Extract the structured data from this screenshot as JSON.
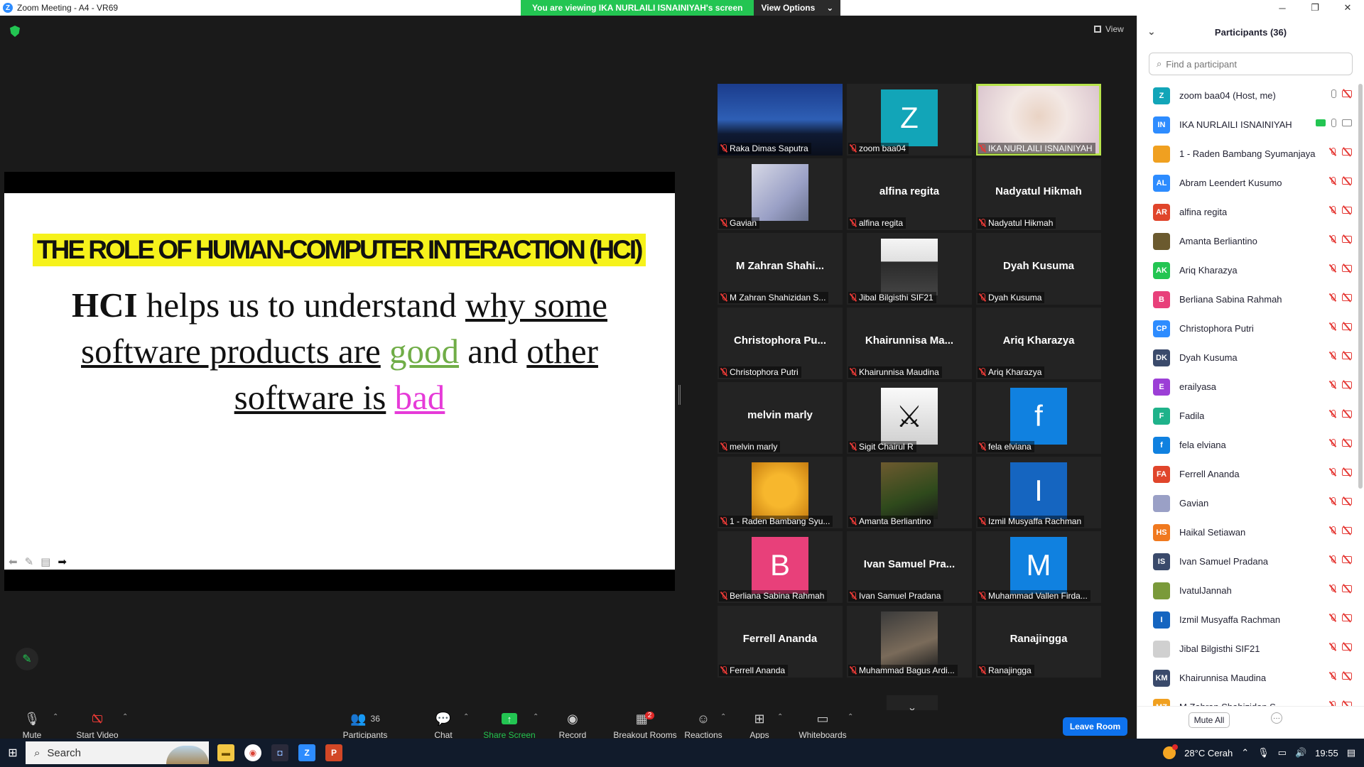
{
  "window": {
    "title": "Zoom Meeting - A4 - VR69",
    "banner_text": "You are viewing IKA NURLAILI ISNAINIYAH's screen",
    "view_options_label": "View Options",
    "minimize": "─",
    "restore": "❐",
    "close": "✕"
  },
  "top_view_label": "View",
  "slide": {
    "title": "THE ROLE OF HUMAN-COMPUTER INTERACTION (HCI)",
    "body": {
      "hci": "HCI",
      "t1": " helps us to understand ",
      "u1": "why some software products are",
      "t2": " ",
      "good": "good",
      "t3": " and ",
      "u2": "other software is",
      "t4": " ",
      "bad": "bad"
    }
  },
  "gallery": {
    "tiles": [
      {
        "name": "Raka Dimas Saputra",
        "center": "",
        "thumb": "",
        "style": "city"
      },
      {
        "name": "zoom baa04",
        "center": "",
        "thumb": "Z",
        "style": "avatar",
        "color": "#12a5b8"
      },
      {
        "name": "IKA NURLAILI ISNAINIYAH",
        "center": "",
        "thumb": "",
        "style": "face",
        "active": true
      },
      {
        "name": "Gavian",
        "center": "",
        "thumb": "",
        "style": "anime"
      },
      {
        "name": "alfina regita",
        "center": "alfina regita",
        "thumb": "",
        "style": "none"
      },
      {
        "name": "Nadyatul Hikmah",
        "center": "Nadyatul Hikmah",
        "thumb": "",
        "style": "none"
      },
      {
        "name": "M Zahran Shahizidan S...",
        "center": "M Zahran Shahi...",
        "thumb": "",
        "style": "none"
      },
      {
        "name": "Jibal Bilgisthi SIF21",
        "center": "",
        "thumb": "",
        "style": "man"
      },
      {
        "name": "Dyah Kusuma",
        "center": "Dyah Kusuma",
        "thumb": "",
        "style": "none"
      },
      {
        "name": "Christophora Putri",
        "center": "Christophora Pu...",
        "thumb": "",
        "style": "none"
      },
      {
        "name": "Khairunnisa Maudina",
        "center": "Khairunnisa Ma...",
        "thumb": "",
        "style": "none"
      },
      {
        "name": "Ariq Kharazya",
        "center": "Ariq Kharazya",
        "thumb": "",
        "style": "none"
      },
      {
        "name": "melvin marly",
        "center": "melvin marly",
        "thumb": "",
        "style": "none"
      },
      {
        "name": "Sigit Chairul R",
        "center": "",
        "thumb": "⚔",
        "style": "samurai"
      },
      {
        "name": "fela elviana",
        "center": "",
        "thumb": "f",
        "style": "avatar",
        "color": "#1081e0"
      },
      {
        "name": "1 - Raden Bambang Syu...",
        "center": "",
        "thumb": "",
        "style": "jake"
      },
      {
        "name": "Amanta Berliantino",
        "center": "",
        "thumb": "",
        "style": "forest"
      },
      {
        "name": "Izmil Musyaffa Rachman",
        "center": "",
        "thumb": "I",
        "style": "avatar",
        "color": "#1565c0"
      },
      {
        "name": "Berliana Sabina Rahmah",
        "center": "",
        "thumb": "B",
        "style": "avatar",
        "color": "#e8407a"
      },
      {
        "name": "Ivan Samuel Pradana",
        "center": "Ivan Samuel Pra...",
        "thumb": "",
        "style": "none"
      },
      {
        "name": "Muhammad Vallen Firda...",
        "center": "",
        "thumb": "M",
        "style": "avatar",
        "color": "#1081e0"
      },
      {
        "name": "Ferrell Ananda",
        "center": "Ferrell Ananda",
        "thumb": "",
        "style": "none"
      },
      {
        "name": "Muhammad Bagus Ardi...",
        "center": "",
        "thumb": "",
        "style": "party"
      },
      {
        "name": "Ranajingga",
        "center": "Ranajingga",
        "thumb": "",
        "style": "none"
      }
    ],
    "more_icon": "⌄"
  },
  "toolbar": {
    "mute": "Mute",
    "start_video": "Start Video",
    "participants": "Participants",
    "participants_count": "36",
    "chat": "Chat",
    "share_screen": "Share Screen",
    "record": "Record",
    "breakout_rooms": "Breakout Rooms",
    "breakout_badge": "2",
    "reactions": "Reactions",
    "apps": "Apps",
    "whiteboards": "Whiteboards",
    "leave": "Leave Room"
  },
  "panel": {
    "title": "Participants (36)",
    "search_placeholder": "Find a participant",
    "participants": [
      {
        "initials": "Z",
        "name": "zoom baa04 (Host, me)",
        "color": "#12a5b8",
        "mic": "on-gray",
        "share": false
      },
      {
        "initials": "IN",
        "name": "IKA NURLAILI ISNAINIYAH",
        "color": "#2d8cff",
        "mic": "on-gray",
        "share": true
      },
      {
        "initials": "",
        "name": "1 - Raden Bambang Syumanjaya",
        "color": "#f0a020",
        "mic": "off",
        "share": false
      },
      {
        "initials": "AL",
        "name": "Abram Leendert Kusumo",
        "color": "#2d8cff",
        "mic": "off",
        "share": false
      },
      {
        "initials": "AR",
        "name": "alfina regita",
        "color": "#e0452b",
        "mic": "off",
        "share": false
      },
      {
        "initials": "",
        "name": "Amanta Berliantino",
        "color": "#6b5a2f",
        "mic": "off",
        "share": false
      },
      {
        "initials": "AK",
        "name": "Ariq Kharazya",
        "color": "#23c552",
        "mic": "off",
        "share": false
      },
      {
        "initials": "B",
        "name": "Berliana Sabina Rahmah",
        "color": "#e8407a",
        "mic": "off",
        "share": false
      },
      {
        "initials": "CP",
        "name": "Christophora Putri",
        "color": "#2d8cff",
        "mic": "off",
        "share": false
      },
      {
        "initials": "DK",
        "name": "Dyah Kusuma",
        "color": "#3a4a6b",
        "mic": "off",
        "share": false
      },
      {
        "initials": "E",
        "name": "erailyasa",
        "color": "#9c3fd6",
        "mic": "off",
        "share": false
      },
      {
        "initials": "F",
        "name": "Fadila",
        "color": "#1fb28a",
        "mic": "off",
        "share": false
      },
      {
        "initials": "f",
        "name": "fela elviana",
        "color": "#1081e0",
        "mic": "off",
        "share": false
      },
      {
        "initials": "FA",
        "name": "Ferrell Ananda",
        "color": "#e0452b",
        "mic": "off",
        "share": false
      },
      {
        "initials": "",
        "name": "Gavian",
        "color": "#9aa0c6",
        "mic": "off",
        "share": false
      },
      {
        "initials": "HS",
        "name": "Haikal Setiawan",
        "color": "#f0791f",
        "mic": "off",
        "share": false
      },
      {
        "initials": "IS",
        "name": "Ivan Samuel Pradana",
        "color": "#3a4a6b",
        "mic": "off",
        "share": false
      },
      {
        "initials": "",
        "name": "IvatulJannah",
        "color": "#7a9a3a",
        "mic": "off",
        "share": false
      },
      {
        "initials": "I",
        "name": "Izmil Musyaffa Rachman",
        "color": "#1565c0",
        "mic": "off",
        "share": false
      },
      {
        "initials": "",
        "name": "Jibal Bilgisthi SIF21",
        "color": "#d0d0d0",
        "mic": "off",
        "share": false
      },
      {
        "initials": "KM",
        "name": "Khairunnisa Maudina",
        "color": "#3a4a6b",
        "mic": "off",
        "share": false
      },
      {
        "initials": "MZ",
        "name": "M Zahran Shahizidan S...",
        "color": "#f0a020",
        "mic": "off",
        "share": false
      }
    ],
    "mute_all": "Mute All",
    "more": "···"
  },
  "taskbar": {
    "search": "Search",
    "weather": "28°C  Cerah",
    "time": "19:55"
  }
}
